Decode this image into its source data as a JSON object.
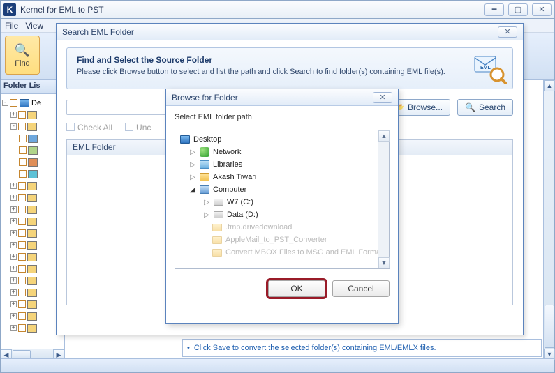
{
  "main": {
    "title": "Kernel for EML to PST",
    "menu": {
      "file": "File",
      "view": "View"
    },
    "find_label": "Find",
    "folder_header": "Folder Lis",
    "tree_root": "De",
    "hint": "Click Save to convert the selected folder(s) containing EML/EMLX files."
  },
  "searchDialog": {
    "title": "Search EML Folder",
    "heading": "Find and Select the Source Folder",
    "sub": "Please click Browse button to select and list the path and click Search to find folder(s) containing EML file(s).",
    "browse": "Browse...",
    "search": "Search",
    "checkAll": "Check All",
    "uncheck": "Unc",
    "gridHeader": "EML Folder"
  },
  "browseDialog": {
    "title": "Browse for Folder",
    "label": "Select EML folder path",
    "ok": "OK",
    "cancel": "Cancel",
    "nodes": {
      "desktop": "Desktop",
      "network": "Network",
      "libraries": "Libraries",
      "user": "Akash Tiwari",
      "computer": "Computer",
      "w7": "W7 (C:)",
      "data": "Data (D:)",
      "tmp": ".tmp.drivedownload",
      "apple": "AppleMail_to_PST_Converter",
      "convert": "Convert MBOX Files to MSG and EML Formats"
    }
  }
}
